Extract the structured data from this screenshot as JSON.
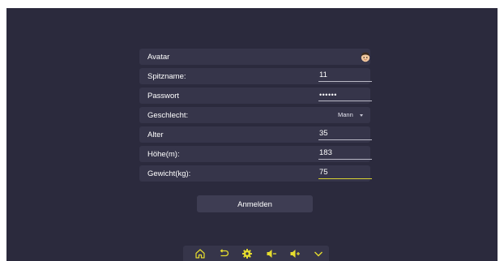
{
  "form": {
    "avatar_label": "Avatar",
    "nickname_label": "Spitzname:",
    "nickname_value": "11",
    "password_label": "Passwort",
    "password_value": "••••••",
    "gender_label": "Geschlecht:",
    "gender_value": "Mann",
    "age_label": "Alter",
    "age_value": "35",
    "height_label": "Höhe(m):",
    "height_value": "183",
    "weight_label": "Gewicht(kg):",
    "weight_value": "75",
    "login_label": "Anmelden"
  },
  "toolbar": {
    "icons": [
      "home-icon",
      "back-icon",
      "settings-icon",
      "volume-down-icon",
      "volume-up-icon",
      "chevron-down-icon"
    ]
  },
  "colors": {
    "background": "#2b2a3d",
    "row": "#36354a",
    "accent": "#e6dd2e"
  }
}
